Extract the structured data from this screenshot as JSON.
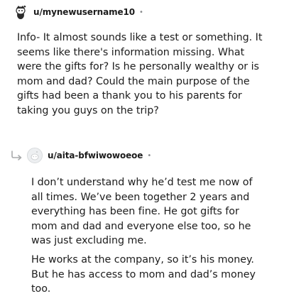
{
  "comments": [
    {
      "username": "u/mynewusername10",
      "separator": "•",
      "avatar_icon": "snoo-avatar-icon",
      "body": "Info- It almost sounds like a test or something. It seems like there's information missing. What were the gifts for? Is he personally wealthy or is mom and dad? Could the main purpose of the gifts had been a thank you to his parents for taking you guys on the trip?"
    },
    {
      "username": "u/aita-bfwiwowoeoe",
      "separator": "•",
      "avatar_icon": "default-avatar-icon",
      "reply_icon": "reply-arrow-icon",
      "paragraphs": [
        "I don’t understand why he’d test me now of all times. We’ve been together 2 years and everything has been fine. He got gifts for mom and dad and everyone else too, so he was just excluding me.",
        "He works at the company, so it’s his money. But he has access to mom and dad’s money too."
      ]
    }
  ]
}
